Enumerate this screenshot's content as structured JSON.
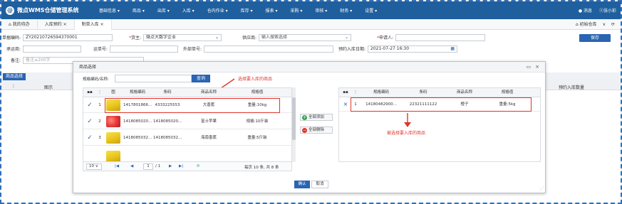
{
  "app": {
    "logo_mark": "@",
    "title": "微点WMS仓储管理系统"
  },
  "nav": [
    "基础信息 ▾",
    "商品 ▾",
    "出库 ▾",
    "入库 ▾",
    "仓内作业 ▾",
    "库存 ▾",
    "报表 ▾",
    "采购 ▾",
    "审核 ▾",
    "财务 ▾",
    "设置 ▾"
  ],
  "top_right": {
    "messages": "消息",
    "user": "ⓧ张小彩"
  },
  "tabs": [
    "我的待办",
    "入库预约 ×",
    "制单入库 ×"
  ],
  "tabbar_right": {
    "warehouse": "初始仓库",
    "chevron": "∨",
    "refresh": "⟳"
  },
  "form": {
    "doc_no_label": "单据编码:",
    "doc_no_value": "ZY20210726594370001",
    "owner_label": "货主:",
    "owner_value": "微点大数字企业",
    "supplier_label": "供应商:",
    "supplier_placeholder": "输入搜索选择",
    "applicant_label": "申请人:",
    "carrier_label": "承运商:",
    "waybill_label": "运单号:",
    "ext_no_label": "外部单号:",
    "expected_label": "预约入库日期:",
    "expected_value": "2021-07-27 16:30",
    "remark_label": "备注:",
    "remark_placeholder": "备注≤200字",
    "required_mark": "*",
    "save_label": "保存"
  },
  "select_goods_label": "商品选择",
  "grid_headers": {
    "menu": "⋮",
    "image": "图示",
    "qty": "预约入库数量"
  },
  "modal": {
    "title": "商品选择",
    "ctrl_max": "▭",
    "ctrl_close": "×",
    "search_label": "规格编码/名称:",
    "search_btn": "查询",
    "annot_left": "选择要入库的商品",
    "annot_right": "被选择要入库的商品",
    "left_headers": [
      "⋮",
      "图",
      "规格编码",
      "条码",
      "商品名称",
      "规格值"
    ],
    "rows": [
      {
        "idx": "1",
        "code": "1417801866...",
        "barcode": "4333225553",
        "name": "大香蕉",
        "spec": "重量:10kg",
        "img": "banana"
      },
      {
        "idx": "2",
        "code": "1418085020...",
        "barcode": "1418085020...",
        "name": "富士苹果",
        "spec": "规格:10斤装",
        "img": "apple"
      },
      {
        "idx": "3",
        "code": "1418085032...",
        "barcode": "1418085032...",
        "name": "海南香蕉",
        "spec": "重量:5斤装",
        "img": "banana"
      }
    ],
    "check_mark": "✓",
    "right_headers": [
      "⋮",
      "规格编码",
      "条码",
      "商品名称",
      "规格值"
    ],
    "right_rows": [
      {
        "remove": "×",
        "idx": "1",
        "code": "14180482900...",
        "barcode": "22321111122",
        "name": "橙子",
        "spec": "重量:5kg"
      }
    ],
    "add_all": "全部添加",
    "remove_all": "全部删除",
    "pager": {
      "size": "10 ∨",
      "first": "|◀",
      "prev": "◀",
      "page": "1",
      "of": "/ 1",
      "next": "▶",
      "last": "▶|",
      "refresh": "⟳",
      "summary": "每页 10 条, 共 8 条"
    },
    "confirm": "确认",
    "cancel": "取消"
  }
}
